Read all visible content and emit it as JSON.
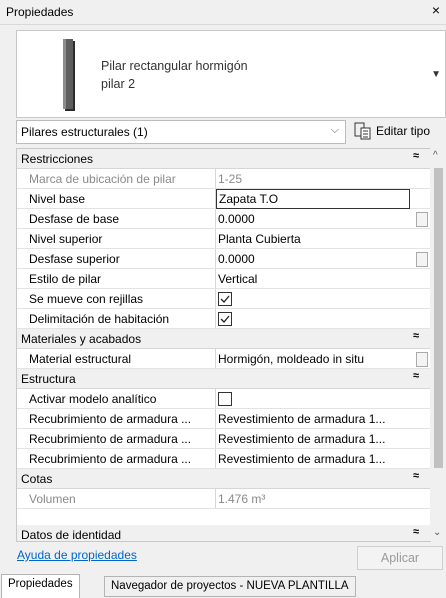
{
  "window": {
    "title": "Propiedades",
    "close_glyph": "×"
  },
  "type_selector": {
    "family": "Pilar rectangular hormigón",
    "type": "pilar 2",
    "dropdown_glyph": "▼"
  },
  "filter": {
    "selected": "Pilares estructurales (1)",
    "chevron": "⌵",
    "edit_type_label": "Editar tipo"
  },
  "sections": [
    {
      "name": "Restricciones",
      "collapse_glyph": "≈"
    },
    {
      "name": "Materiales y acabados",
      "collapse_glyph": "≈"
    },
    {
      "name": "Estructura",
      "collapse_glyph": "≈"
    },
    {
      "name": "Cotas",
      "collapse_glyph": "≈"
    },
    {
      "name": "Datos de identidad",
      "collapse_glyph": "≈"
    }
  ],
  "restricciones": [
    {
      "name": "Marca de ubicación de pilar",
      "value": "1-25",
      "readonly": true
    },
    {
      "name": "Nivel base",
      "value": "Zapata T.O",
      "editing": true
    },
    {
      "name": "Desfase de base",
      "value": "0.0000"
    },
    {
      "name": "Nivel superior",
      "value": "Planta Cubierta"
    },
    {
      "name": "Desfase superior",
      "value": "0.0000"
    },
    {
      "name": "Estilo de pilar",
      "value": "Vertical"
    },
    {
      "name": "Se mueve con rejillas",
      "checked": true
    },
    {
      "name": "Delimitación de habitación",
      "checked": true
    }
  ],
  "materiales": [
    {
      "name": "Material estructural",
      "value": "Hormigón, moldeado in situ"
    }
  ],
  "estructura": [
    {
      "name": "Activar modelo analítico",
      "checked": false
    },
    {
      "name": "Recubrimiento de armadura ...",
      "value": "Revestimiento de armadura 1..."
    },
    {
      "name": "Recubrimiento de armadura ...",
      "value": "Revestimiento de armadura 1..."
    },
    {
      "name": "Recubrimiento de armadura ...",
      "value": "Revestimiento de armadura 1..."
    }
  ],
  "cotas": [
    {
      "name": "Volumen",
      "value": "1.476 m³",
      "readonly": true
    }
  ],
  "footer": {
    "help_link": "Ayuda de propiedades",
    "apply_label": "Aplicar"
  },
  "tabs": [
    {
      "label": "Propiedades",
      "active": true
    },
    {
      "label": "Navegador de proyectos - NUEVA PLANTILLA",
      "active": false
    }
  ],
  "scrollbar": {
    "up_glyph": "^",
    "down_glyph": "⌄"
  }
}
